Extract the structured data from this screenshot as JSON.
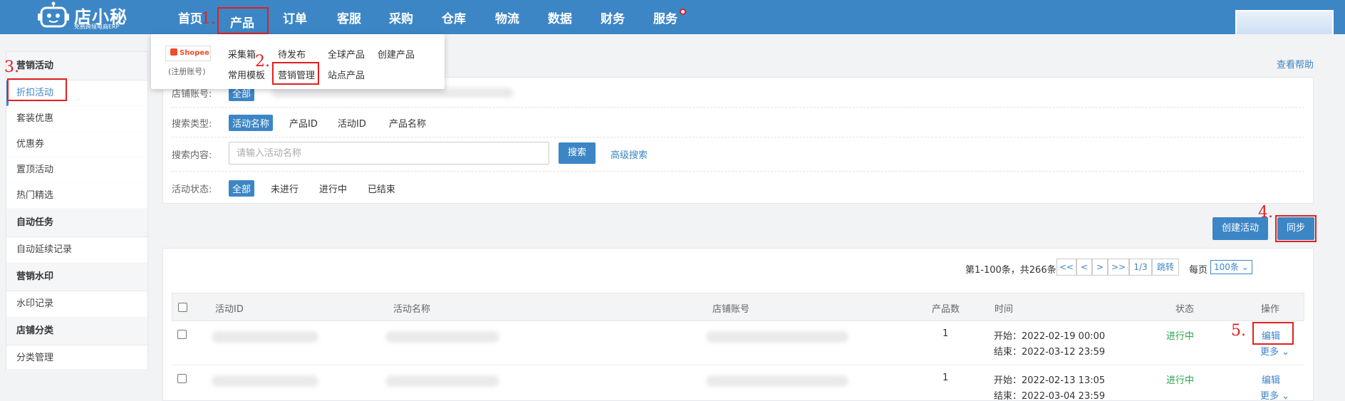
{
  "header": {
    "logo_name": "店小秘",
    "logo_sub": "免费跨境电商ERP",
    "nav": [
      "首页",
      "产品",
      "订单",
      "客服",
      "采购",
      "仓库",
      "物流",
      "数据",
      "财务",
      "服务"
    ]
  },
  "annotations": [
    "1.",
    "2.",
    "3.",
    "4.",
    "5."
  ],
  "dropdown": {
    "platform": "Shopee",
    "note": "(注册账号)",
    "row1": [
      "采集箱",
      "待发布",
      "全球产品",
      "创建产品"
    ],
    "row2": [
      "常用模板",
      "营销管理",
      "站点产品"
    ]
  },
  "sidebar": {
    "groups": [
      {
        "title": "营销活动",
        "items": [
          "折扣活动",
          "套装优惠",
          "优惠券",
          "置顶活动",
          "热门精选"
        ]
      },
      {
        "title": "自动任务",
        "items": [
          "自动延续记录"
        ]
      },
      {
        "title": "营销水印",
        "items": [
          "水印记录"
        ]
      },
      {
        "title": "店铺分类",
        "items": [
          "分类管理"
        ]
      }
    ]
  },
  "help_link": "查看帮助",
  "filters": {
    "shop_label": "店铺账号:",
    "shop_all": "全部",
    "search_type_label": "搜索类型:",
    "search_types": [
      "活动名称",
      "产品ID",
      "活动ID",
      "产品名称"
    ],
    "content_label": "搜索内容:",
    "content_placeholder": "请输入活动名称",
    "search_button": "搜索",
    "advanced_search": "高级搜索",
    "status_label": "活动状态:",
    "statuses": [
      "全部",
      "未进行",
      "进行中",
      "已结束"
    ]
  },
  "actions": {
    "create": "创建活动",
    "sync": "同步"
  },
  "pager": {
    "summary": "第1-100条，共266条",
    "first": "<<",
    "prev": "<",
    "next": ">",
    "last": ">>",
    "page": "1/3",
    "jump": "跳转",
    "per_page_label": "每页",
    "per_page": "100条"
  },
  "table": {
    "columns": [
      "活动ID",
      "活动名称",
      "店铺账号",
      "产品数",
      "时间",
      "状态",
      "操作"
    ],
    "rows": [
      {
        "count": "1",
        "start": "开始：2022-02-19 00:00",
        "end": "结束：2022-03-12 23:59",
        "status": "进行中",
        "edit": "编辑",
        "more": "更多"
      },
      {
        "count": "1",
        "start": "开始：2022-02-13 13:05",
        "end": "结束：2022-03-04 23:59",
        "status": "进行中",
        "edit": "编辑",
        "more": "更多"
      }
    ]
  }
}
